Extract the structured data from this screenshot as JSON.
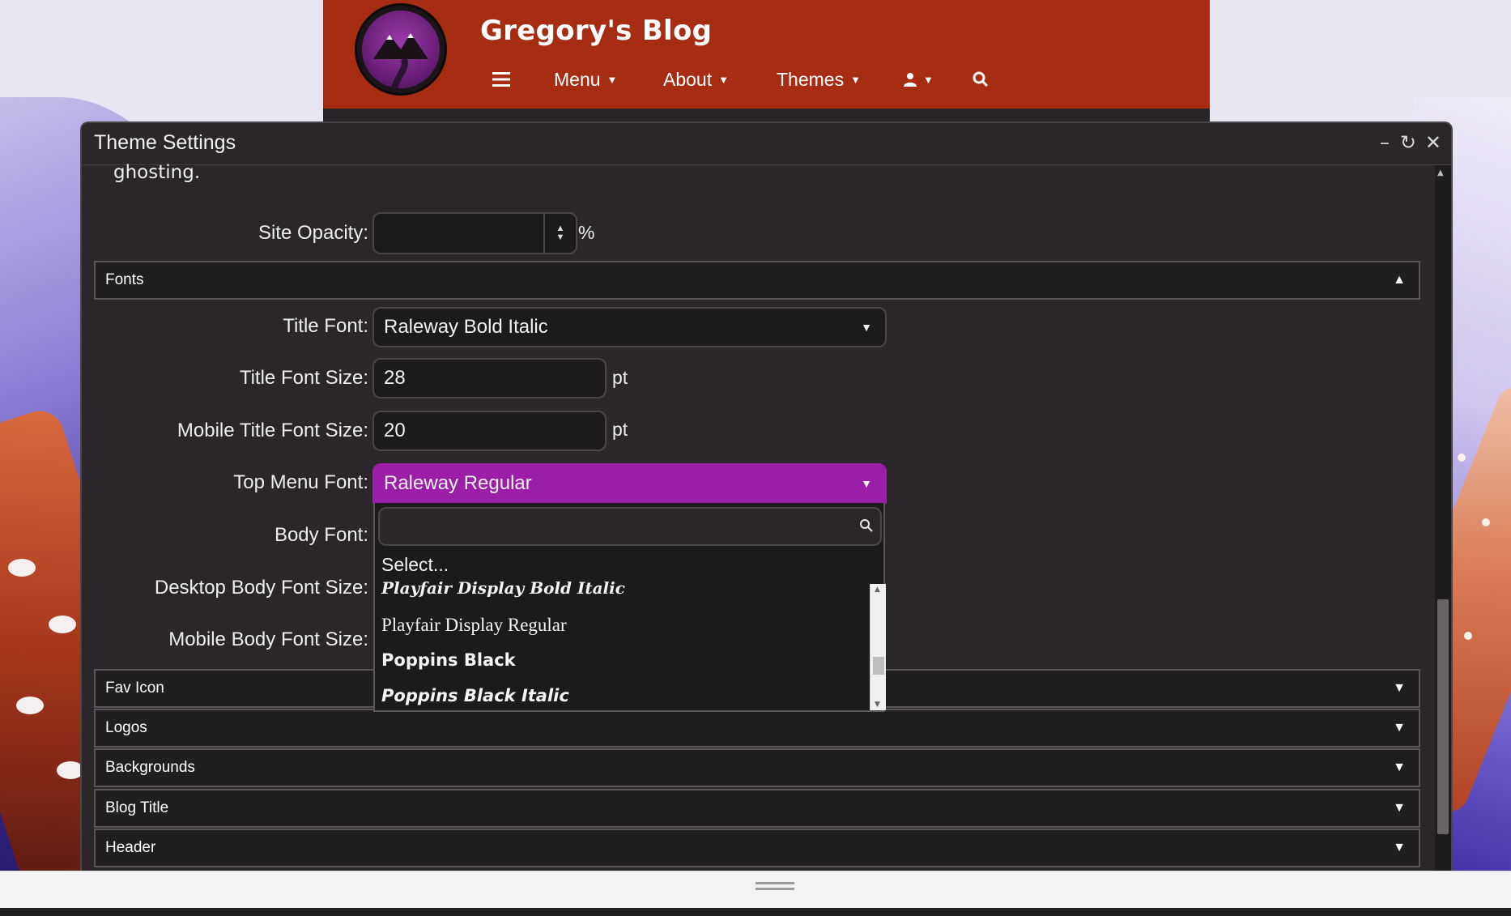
{
  "site": {
    "title": "Gregory's Blog",
    "nav": [
      {
        "label": "",
        "icon": "hamburger-icon"
      },
      {
        "label": "Menu",
        "caret": "▼"
      },
      {
        "label": "About",
        "caret": "▼"
      },
      {
        "label": "Themes",
        "caret": "▼"
      },
      {
        "label": "",
        "icon": "user-icon",
        "caret": "▼"
      },
      {
        "label": "",
        "icon": "search-icon"
      }
    ],
    "header_color": "#a62c12"
  },
  "dialog": {
    "title": "Theme Settings",
    "controls": {
      "minimize": "–",
      "restore": "↻",
      "close": "✕"
    },
    "intro_text": "ghosting.",
    "site_opacity": {
      "label": "Site Opacity:",
      "value": "",
      "unit": "%"
    },
    "sections": {
      "fonts": {
        "label": "Fonts",
        "arrow": "▲"
      },
      "fav_icon": {
        "label": "Fav Icon",
        "arrow": "▼"
      },
      "logos": {
        "label": "Logos",
        "arrow": "▼"
      },
      "backgrounds": {
        "label": "Backgrounds",
        "arrow": "▼"
      },
      "blog_title": {
        "label": "Blog Title",
        "arrow": "▼"
      },
      "header": {
        "label": "Header",
        "arrow": "▼"
      }
    },
    "fonts": {
      "title_font": {
        "label": "Title Font:",
        "value": "Raleway Bold Italic"
      },
      "title_font_size": {
        "label": "Title Font Size:",
        "value": "28",
        "unit": "pt"
      },
      "mobile_title_font_size": {
        "label": "Mobile Title Font Size:",
        "value": "20",
        "unit": "pt"
      },
      "top_menu_font": {
        "label": "Top Menu Font:",
        "value": "Raleway Regular"
      },
      "body_font": {
        "label": "Body Font:"
      },
      "desktop_body_font_size": {
        "label": "Desktop Body Font Size:"
      },
      "mobile_body_font_size": {
        "label": "Mobile Body Font Size:"
      }
    },
    "dropdown": {
      "search_value": "",
      "options": [
        {
          "label": "Select..."
        },
        {
          "label": "Playfair Display Bold Italic"
        },
        {
          "label": "Playfair Display Regular"
        },
        {
          "label": "Poppins Black"
        },
        {
          "label": "Poppins Black Italic"
        }
      ]
    }
  },
  "colors": {
    "accent_purple": "#9b1fa6",
    "dialog_bg": "#2a2629",
    "input_bg": "#1d1a1c"
  }
}
